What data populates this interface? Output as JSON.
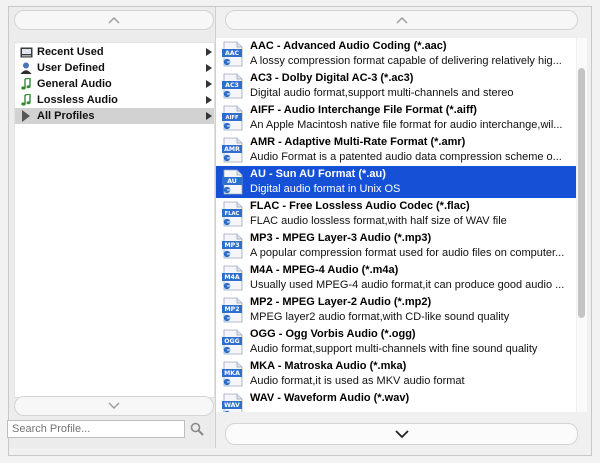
{
  "categories": [
    {
      "label": "Recent Used",
      "icon": "recent-icon"
    },
    {
      "label": "User Defined",
      "icon": "user-icon"
    },
    {
      "label": "General Audio",
      "icon": "music-note-icon"
    },
    {
      "label": "Lossless Audio",
      "icon": "music-note-icon"
    },
    {
      "label": "All Profiles",
      "icon": "play-icon",
      "selected": true
    }
  ],
  "search": {
    "placeholder": "Search Profile..."
  },
  "formats": [
    {
      "title": "AAC - Advanced Audio Coding (*.aac)",
      "desc": "A lossy compression format capable of delivering relatively hig...",
      "badge": "AAC"
    },
    {
      "title": "AC3 - Dolby Digital AC-3 (*.ac3)",
      "desc": "Digital audio format,support multi-channels and stereo",
      "badge": "AC3"
    },
    {
      "title": "AIFF - Audio Interchange File Format (*.aiff)",
      "desc": "An Apple Macintosh native file format for audio interchange,wil...",
      "badge": "AIFF"
    },
    {
      "title": "AMR - Adaptive Multi-Rate Format (*.amr)",
      "desc": "Audio Format is a patented audio data compression scheme o...",
      "badge": "AMR"
    },
    {
      "title": "AU - Sun AU Format (*.au)",
      "desc": "Digital audio format in Unix OS",
      "badge": "AU",
      "selected": true
    },
    {
      "title": "FLAC - Free Lossless Audio Codec (*.flac)",
      "desc": "FLAC audio lossless format,with half size of WAV file",
      "badge": "FLAC"
    },
    {
      "title": "MP3 - MPEG Layer-3 Audio (*.mp3)",
      "desc": "A popular compression format used for audio files on computer...",
      "badge": "MP3"
    },
    {
      "title": "M4A - MPEG-4 Audio (*.m4a)",
      "desc": "Usually used MPEG-4 audio format,it can produce good audio ...",
      "badge": "M4A"
    },
    {
      "title": "MP2 - MPEG Layer-2 Audio (*.mp2)",
      "desc": "MPEG layer2 audio format,with CD-like sound quality",
      "badge": "MP2"
    },
    {
      "title": "OGG - Ogg Vorbis Audio (*.ogg)",
      "desc": "Audio format,support multi-channels with fine sound quality",
      "badge": "OGG"
    },
    {
      "title": "MKA - Matroska Audio (*.mka)",
      "desc": "Audio format,it is used as MKV audio format",
      "badge": "MKA"
    },
    {
      "title": "WAV - Waveform Audio (*.wav)",
      "desc": "",
      "badge": "WAV"
    }
  ],
  "colors": {
    "selection": "#1550d6",
    "badge": "#2e6fce"
  }
}
